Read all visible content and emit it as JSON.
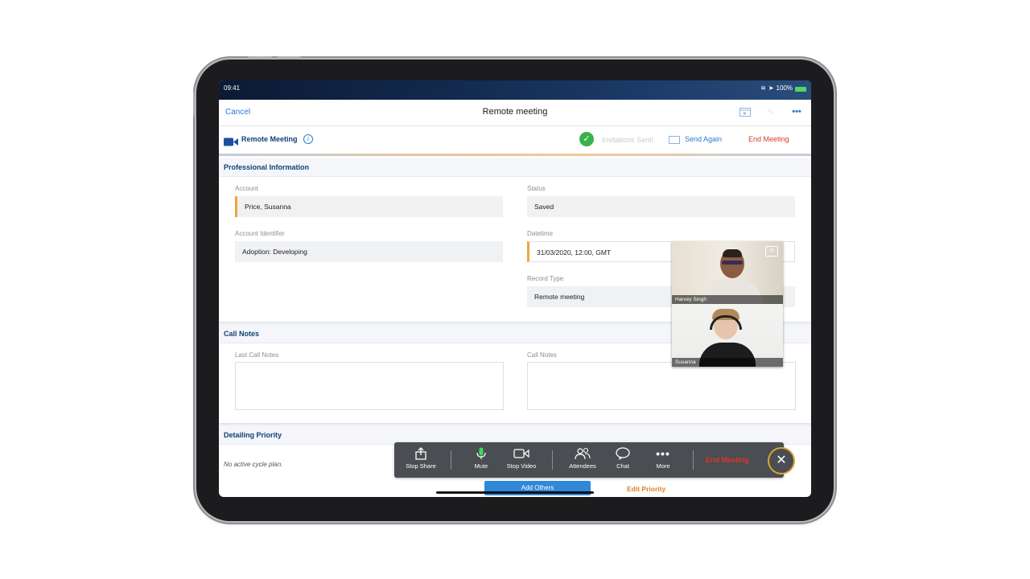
{
  "status_bar": {
    "time": "09:41",
    "battery": "100%"
  },
  "navbar": {
    "cancel": "Cancel",
    "title": "Remote meeting"
  },
  "meeting_bar": {
    "label": "Remote Meeting",
    "invitations_status": "Invitations Sent!",
    "send_again": "Send Again",
    "end_meeting": "End Meeting"
  },
  "professional": {
    "header": "Professional Information",
    "account_label": "Account",
    "account_value": "Price, Susanna",
    "status_label": "Status",
    "status_value": "Saved",
    "account_id_label": "Account Identifier",
    "account_id_value": "Adoption: Developing",
    "datetime_label": "Datetime",
    "datetime_value": "31/03/2020, 12:00, GMT",
    "record_type_label": "Record Type",
    "record_type_value": "Remote meeting"
  },
  "call_notes": {
    "header": "Call Notes",
    "last_label": "Last Call Notes",
    "notes_label": "Call Notes"
  },
  "detailing": {
    "header": "Detailing Priority",
    "note": "No active cycle plan.",
    "add_others": "Add Others",
    "edit_priority": "Edit Priority"
  },
  "video": {
    "participant1": "Harvey Singh",
    "participant2": "Susanna"
  },
  "toolbar": {
    "stop_share": "Stop Share",
    "mute": "Mute",
    "stop_video": "Stop Video",
    "attendees": "Attendees",
    "chat": "Chat",
    "more": "More",
    "end_meeting": "End Meeting"
  },
  "colors": {
    "accent": "#2a7bd4",
    "section_title": "#123f78",
    "danger": "#d33b2f",
    "required": "#f0a53a"
  }
}
